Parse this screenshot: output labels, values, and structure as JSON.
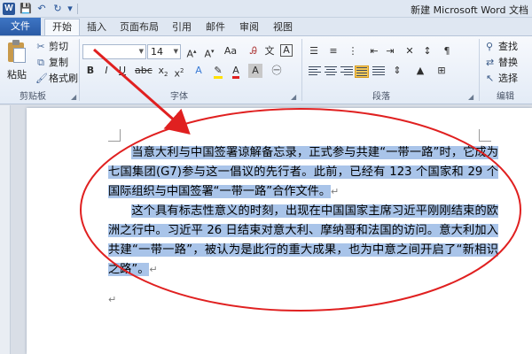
{
  "title_bar": {
    "app_logo": "W",
    "title": "新建 Microsoft Word 文档",
    "quick_access": [
      {
        "icon": "save-icon",
        "glyph": "💾"
      },
      {
        "icon": "undo-icon",
        "glyph": "↶"
      },
      {
        "icon": "redo-icon",
        "glyph": "↻"
      },
      {
        "icon": "customize-icon",
        "glyph": "▾"
      }
    ]
  },
  "tabs": {
    "file": "文件",
    "items": [
      "开始",
      "插入",
      "页面布局",
      "引用",
      "邮件",
      "审阅",
      "视图"
    ],
    "active": "开始"
  },
  "ribbon": {
    "clipboard": {
      "paste": "粘贴",
      "cut": "剪切",
      "copy": "复制",
      "format_painter": "格式刷",
      "label": "剪贴板"
    },
    "font": {
      "font_name": "",
      "font_size": "14",
      "label": "字体"
    },
    "paragraph": {
      "label": "段落"
    },
    "editing": {
      "find": "查找",
      "replace": "替换",
      "select": "选择",
      "label": "编辑"
    }
  },
  "document": {
    "paragraph1": "当意大利与中国签署谅解备忘录，正式参与共建“一带一路”时，它成为七国集团(G7)参与这一倡议的先行者。此前，已经有 123 个国家和 29 个国际组织与中国签署“一带一路”合作文件。",
    "paragraph2": "这个具有标志性意义的时刻，出现在中国国家主席习近平刚刚结束的欧洲之行中。习近平 26 日结束对意大利、摩纳哥和法国的访问。意大利加入共建“一带一路”，被认为是此行的重大成果，也为中意之间开启了“新相识之路”。",
    "paragraph_mark": "↵"
  },
  "colors": {
    "selection": "#a9c4e9",
    "annotation": "#e02020",
    "file_tab": "#2b579a"
  }
}
